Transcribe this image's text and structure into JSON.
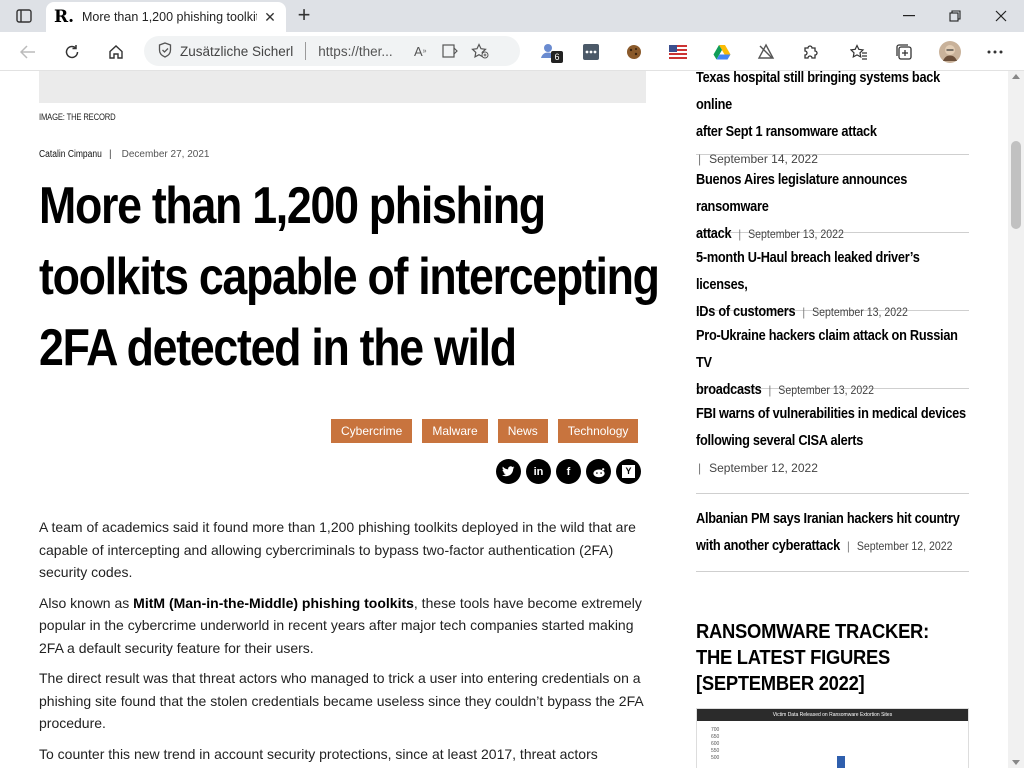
{
  "browser": {
    "tab_title": "More than 1,200 phishing toolkit",
    "favicon_letter": "R.",
    "address_security_label": "Zusätzliche Sicherl",
    "address_url": "https://ther...",
    "extension_badge_count": "6",
    "colors": {
      "titlebar": "#dee1e6",
      "tab": "#ffffff",
      "addressbar": "#f1f3f4"
    }
  },
  "article": {
    "image_caption": "IMAGE: THE RECORD",
    "author": "Catalin Cimpanu",
    "date": "December 27, 2021",
    "headline_lines": [
      "More than 1,200 phishing",
      "toolkits capable of intercepting",
      "2FA detected in the wild"
    ],
    "tags": [
      "Cybercrime",
      "Malware",
      "News",
      "Technology"
    ],
    "tag_color": "#c8743e",
    "share_icons": [
      "twitter-icon",
      "linkedin-icon",
      "facebook-icon",
      "reddit-icon",
      "hackernews-icon"
    ],
    "paragraphs": {
      "p1": "A team of academics said it found more than 1,200 phishing toolkits deployed in the wild that are capable of intercepting and allowing cybercriminals to bypass two-factor authentication (2FA) security codes.",
      "p2_prefix": "Also known as ",
      "p2_bold": "MitM (Man-in-the-Middle) phishing toolkits",
      "p2_suffix": ", these tools have become extremely popular in the cybercrime underworld in recent years after major tech companies started making 2FA a default security feature for their users.",
      "p3": "The direct result was that threat actors who managed to trick a user into entering credentials on a phishing site found that the stolen credentials became useless since they couldn’t bypass the 2FA procedure.",
      "p4": "To counter this new trend in account security protections, since at least 2017, threat actors"
    }
  },
  "sidebar": {
    "items": [
      {
        "title_l1": "Texas hospital still bringing systems back online",
        "title_l2": "after Sept 1 ransomware attack",
        "date": "September 14, 2022"
      },
      {
        "title_l1": "Buenos Aires legislature announces ransomware",
        "title_l2": "attack",
        "date": "September 13, 2022"
      },
      {
        "title_l1": "5-month U-Haul breach leaked driver’s licenses,",
        "title_l2": "IDs of customers",
        "date": "September 13, 2022"
      },
      {
        "title_l1": "Pro-Ukraine hackers claim attack on Russian TV",
        "title_l2": "broadcasts",
        "date": "September 13, 2022"
      },
      {
        "title_l1": "FBI warns of vulnerabilities in medical devices",
        "title_l2": "following several CISA alerts",
        "date": "September 12, 2022"
      },
      {
        "title_l1": "Albanian PM says Iranian hackers hit country",
        "title_l2": "with another cyberattack",
        "date": "September 12, 2022"
      }
    ],
    "tracker_title": "RANSOMWARE TRACKER: THE LATEST FIGURES [SEPTEMBER 2022]",
    "tracker_image_header": "Victim Data Released on Ransomware Extortion Sites",
    "tracker_axis": [
      "700",
      "650",
      "600",
      "550",
      "500"
    ]
  }
}
